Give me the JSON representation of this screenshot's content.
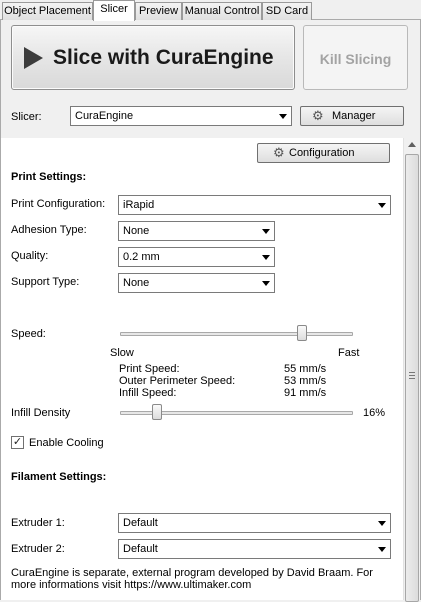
{
  "tabs": [
    {
      "label": "Object Placement"
    },
    {
      "label": "Slicer",
      "active": true
    },
    {
      "label": "Preview"
    },
    {
      "label": "Manual Control"
    },
    {
      "label": "SD Card"
    }
  ],
  "slice_button": {
    "label": "Slice with CuraEngine",
    "icon": "play-icon"
  },
  "kill_button": {
    "label": "Kill Slicing",
    "enabled": false
  },
  "slicer": {
    "label": "Slicer:",
    "value": "CuraEngine",
    "manager_label": "Manager",
    "manager_icon": "gears-icon"
  },
  "configuration_button": {
    "label": "Configuration",
    "icon": "gear-icon"
  },
  "print_settings": {
    "heading": "Print Settings:",
    "print_configuration": {
      "label": "Print Configuration:",
      "value": "iRapid"
    },
    "adhesion_type": {
      "label": "Adhesion Type:",
      "value": "None"
    },
    "quality": {
      "label": "Quality:",
      "value": "0.2 mm"
    },
    "support_type": {
      "label": "Support Type:",
      "value": "None"
    }
  },
  "speed": {
    "label": "Speed:",
    "slow_label": "Slow",
    "fast_label": "Fast",
    "slider_fraction": 0.78,
    "print_speed": {
      "label": "Print Speed:",
      "value": "55 mm/s"
    },
    "outer_perimeter_speed": {
      "label": "Outer Perimeter Speed:",
      "value": "53 mm/s"
    },
    "infill_speed": {
      "label": "Infill Speed:",
      "value": "91 mm/s"
    }
  },
  "infill_density": {
    "label": "Infill Density",
    "value": "16%",
    "fraction": 0.16
  },
  "enable_cooling": {
    "label": "Enable Cooling",
    "checked": true
  },
  "filament_settings": {
    "heading": "Filament Settings:",
    "extruder1": {
      "label": "Extruder 1:",
      "value": "Default"
    },
    "extruder2": {
      "label": "Extruder 2:",
      "value": "Default"
    }
  },
  "footer_text": "CuraEngine is separate, external program developed by David Braam. For more informations visit https://www.ultimaker.com",
  "colors": {
    "panel_bg": "#ffffff",
    "window_bg": "#f0f0f0",
    "disabled_text": "#a3a3a3"
  }
}
